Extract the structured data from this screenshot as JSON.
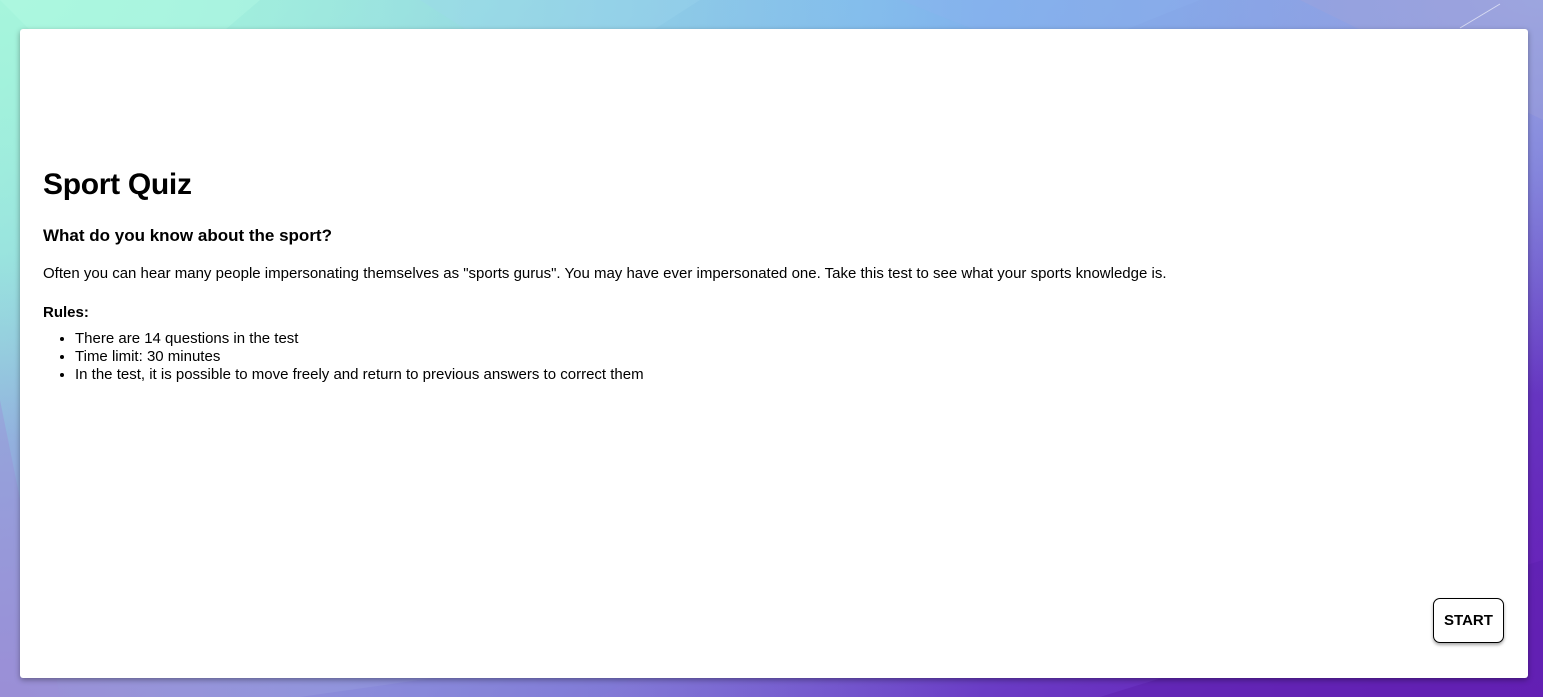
{
  "quiz": {
    "title": "Sport Quiz",
    "subtitle": "What do you know about the sport?",
    "intro": "Often you can hear many people impersonating themselves as \"sports gurus\". You may have ever impersonated one. Take this test to see what your sports knowledge is.",
    "rules_label": "Rules:",
    "rules": [
      "There are 14 questions in the test",
      "Time limit: 30 minutes",
      "In the test, it is possible to move freely and return to previous answers to correct them"
    ],
    "start_label": "START"
  },
  "theme": {
    "card_background": "#ffffff",
    "text_color": "#000000",
    "background_top_left": "#a6f5dc",
    "background_bottom_right": "#5a2bb8"
  }
}
